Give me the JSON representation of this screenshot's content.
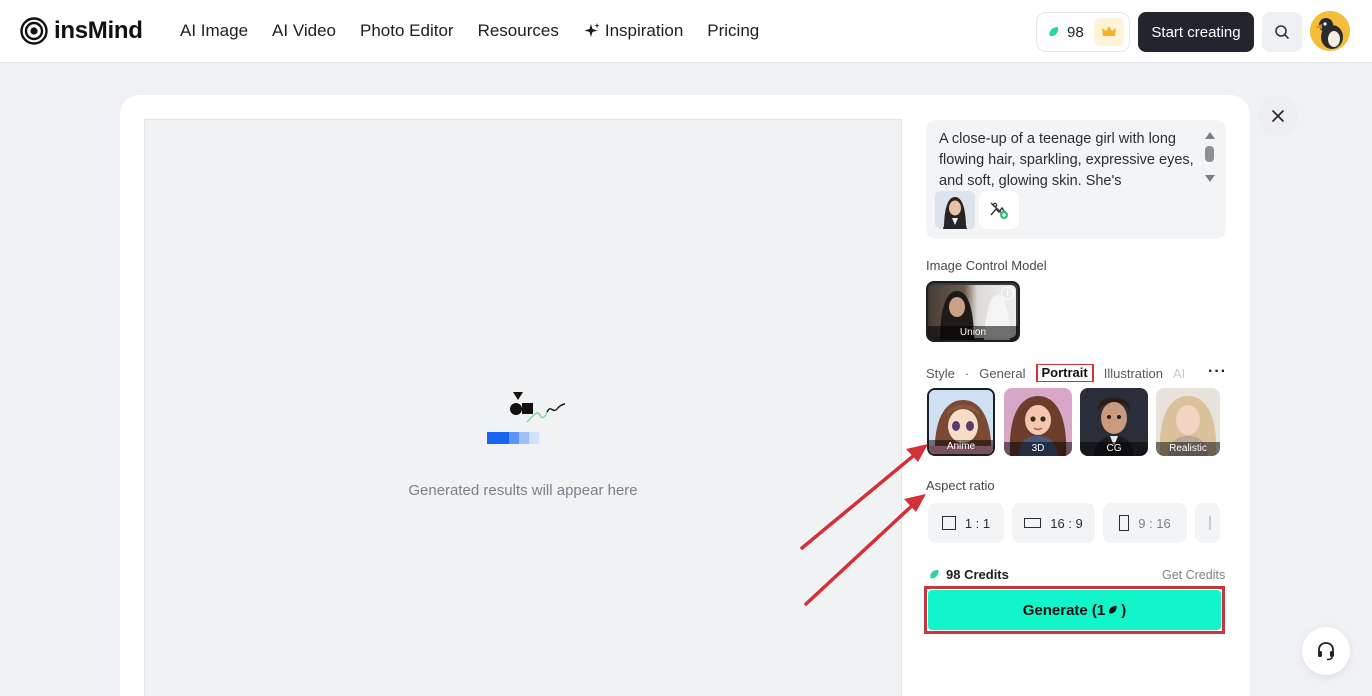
{
  "header": {
    "logo_text": "insMind",
    "nav": [
      "AI Image",
      "AI Video",
      "Photo Editor",
      "Resources",
      "Inspiration",
      "Pricing"
    ],
    "credits_count": "98",
    "start_label": "Start creating"
  },
  "preview": {
    "message": "Generated results will appear here"
  },
  "prompt": {
    "text": "A close-up of a teenage girl with long flowing hair, sparkling, expressive eyes, and soft, glowing skin. She's"
  },
  "image_control": {
    "label": "Image Control Model",
    "model_name": "Union"
  },
  "style": {
    "label": "Style",
    "separator": "·",
    "tabs": [
      "General",
      "Portrait",
      "Illustration",
      "AI"
    ],
    "active_tab": "Portrait",
    "presets": [
      "Anime",
      "3D",
      "CG",
      "Realistic"
    ],
    "selected_preset": "Anime"
  },
  "aspect_ratio": {
    "label": "Aspect ratio",
    "options": [
      "1 : 1",
      "16 : 9",
      "9 : 16"
    ]
  },
  "footer": {
    "credits_label": "98 Credits",
    "get_credits": "Get Credits",
    "generate_label": "Generate (1"
  },
  "colors": {
    "generate_bg": "#12f5cb",
    "highlight_red": "#c9353c",
    "credit_gem": "#2ad3a8"
  }
}
